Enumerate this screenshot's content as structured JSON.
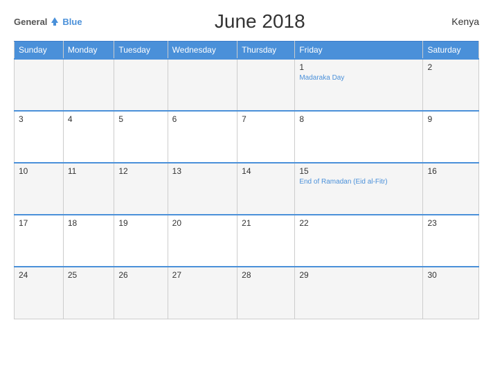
{
  "header": {
    "title": "June 2018",
    "country": "Kenya",
    "logo": {
      "general": "General",
      "blue": "Blue"
    }
  },
  "calendar": {
    "days_of_week": [
      "Sunday",
      "Monday",
      "Tuesday",
      "Wednesday",
      "Thursday",
      "Friday",
      "Saturday"
    ],
    "weeks": [
      [
        {
          "day": "",
          "holiday": ""
        },
        {
          "day": "",
          "holiday": ""
        },
        {
          "day": "",
          "holiday": ""
        },
        {
          "day": "",
          "holiday": ""
        },
        {
          "day": "",
          "holiday": ""
        },
        {
          "day": "1",
          "holiday": "Madaraka Day"
        },
        {
          "day": "2",
          "holiday": ""
        }
      ],
      [
        {
          "day": "3",
          "holiday": ""
        },
        {
          "day": "4",
          "holiday": ""
        },
        {
          "day": "5",
          "holiday": ""
        },
        {
          "day": "6",
          "holiday": ""
        },
        {
          "day": "7",
          "holiday": ""
        },
        {
          "day": "8",
          "holiday": ""
        },
        {
          "day": "9",
          "holiday": ""
        }
      ],
      [
        {
          "day": "10",
          "holiday": ""
        },
        {
          "day": "11",
          "holiday": ""
        },
        {
          "day": "12",
          "holiday": ""
        },
        {
          "day": "13",
          "holiday": ""
        },
        {
          "day": "14",
          "holiday": ""
        },
        {
          "day": "15",
          "holiday": "End of Ramadan (Eid al-Fitr)"
        },
        {
          "day": "16",
          "holiday": ""
        }
      ],
      [
        {
          "day": "17",
          "holiday": ""
        },
        {
          "day": "18",
          "holiday": ""
        },
        {
          "day": "19",
          "holiday": ""
        },
        {
          "day": "20",
          "holiday": ""
        },
        {
          "day": "21",
          "holiday": ""
        },
        {
          "day": "22",
          "holiday": ""
        },
        {
          "day": "23",
          "holiday": ""
        }
      ],
      [
        {
          "day": "24",
          "holiday": ""
        },
        {
          "day": "25",
          "holiday": ""
        },
        {
          "day": "26",
          "holiday": ""
        },
        {
          "day": "27",
          "holiday": ""
        },
        {
          "day": "28",
          "holiday": ""
        },
        {
          "day": "29",
          "holiday": ""
        },
        {
          "day": "30",
          "holiday": ""
        }
      ]
    ]
  }
}
